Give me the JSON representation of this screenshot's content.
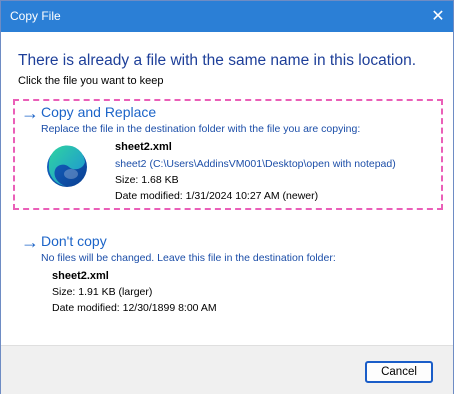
{
  "window": {
    "title": "Copy File",
    "close_glyph": "✕"
  },
  "heading": "There is already a file with the same name in this location.",
  "subheading": "Click the file you want to keep",
  "replace_option": {
    "arrow": "→",
    "title": "Copy and Replace",
    "description": "Replace the file in the destination folder with the file you are copying:",
    "file": {
      "name": "sheet2.xml",
      "path": "sheet2 (C:\\Users\\AddinsVM001\\Desktop\\open with notepad)",
      "size": "Size: 1.68 KB",
      "modified": "Date modified: 1/31/2024 10:27 AM (newer)",
      "icon": "edge-browser-icon"
    }
  },
  "dont_copy_option": {
    "arrow": "→",
    "title": "Don't copy",
    "description": "No files will be changed. Leave this file in the destination folder:",
    "file": {
      "name": "sheet2.xml",
      "size": "Size: 1.91 KB (larger)",
      "modified": "Date modified: 12/30/1899 8:00 AM"
    }
  },
  "footer": {
    "cancel_label": "Cancel"
  },
  "colors": {
    "titlebar": "#2b7fd6",
    "heading": "#1e3f99",
    "link": "#1c64c8",
    "highlight_border": "#ea5fb8"
  }
}
